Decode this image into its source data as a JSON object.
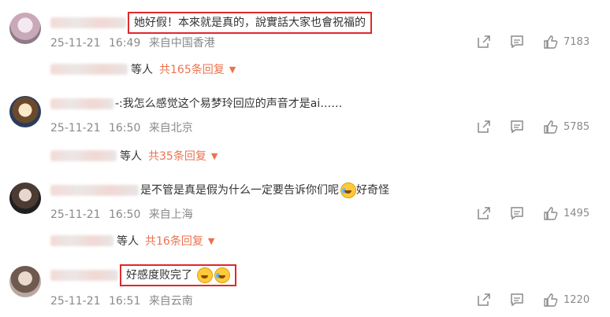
{
  "comments": [
    {
      "text": "她好假！本來就是真的，說實話大家也會祝福的",
      "date": "25-11-21",
      "time": "16:49",
      "location": "来自中国香港",
      "likes": "7183",
      "replies": {
        "who": "等人",
        "count": "共165条回复"
      }
    },
    {
      "text": "-:我怎么感觉这个易梦玲回应的声音才是ai……",
      "date": "25-11-21",
      "time": "16:50",
      "location": "来自北京",
      "likes": "5785",
      "replies": {
        "who": "等人",
        "count": "共35条回复"
      }
    },
    {
      "text": "是不管是真是假为什么一定要告诉你们呢",
      "text_suffix": "好奇怪",
      "date": "25-11-21",
      "time": "16:50",
      "location": "来自上海",
      "likes": "1495",
      "replies": {
        "who": "等人",
        "count": "共16条回复"
      }
    },
    {
      "text": "好感度败完了",
      "date": "25-11-21",
      "time": "16:51",
      "location": "来自云南",
      "likes": "1220"
    }
  ],
  "colors": {
    "highlight_border": "#e0282a",
    "reply_count": "#eb7350",
    "meta": "#8a8a8a"
  },
  "icons": [
    "share-icon",
    "comment-icon",
    "like-icon",
    "caret-down-icon",
    "laugh-cry-emoji",
    "crying-emoji"
  ]
}
